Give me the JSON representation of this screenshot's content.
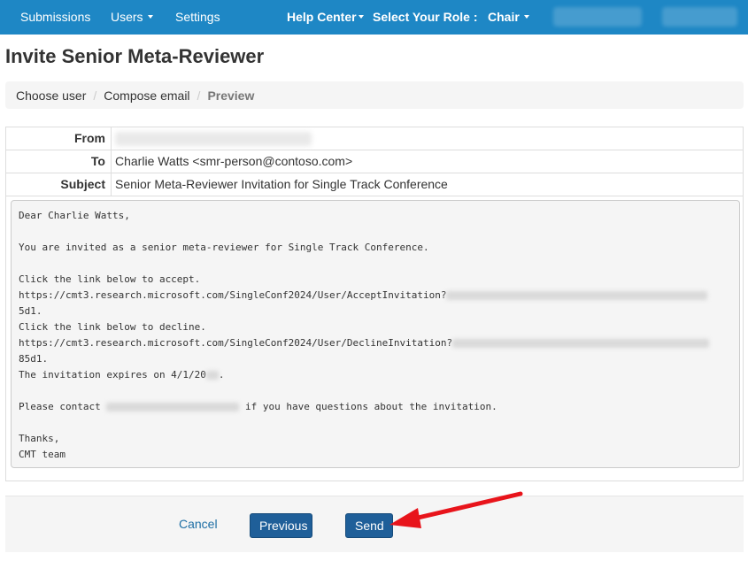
{
  "nav": {
    "submissions": "Submissions",
    "users": "Users",
    "settings": "Settings",
    "help_center": "Help Center",
    "select_role": "Select Your Role :",
    "role": "Chair"
  },
  "page": {
    "title": "Invite Senior Meta-Reviewer"
  },
  "breadcrumb": {
    "items": [
      {
        "label": "Choose user"
      },
      {
        "label": "Compose email"
      },
      {
        "label": "Preview"
      }
    ],
    "separator": "/"
  },
  "email": {
    "from_label": "From",
    "to_label": "To",
    "to_value": "Charlie Watts <smr-person@contoso.com>",
    "subject_label": "Subject",
    "subject_value": "Senior Meta-Reviewer Invitation for Single Track Conference",
    "body": {
      "greeting": "Dear Charlie Watts,",
      "intro": "You are invited as a senior meta-reviewer for Single Track Conference.",
      "accept_line": "Click the link below to accept.",
      "accept_url": "https://cmt3.research.microsoft.com/SingleConf2024/User/AcceptInvitation?",
      "accept_tail": "5d1.",
      "decline_line": "Click the link below to decline.",
      "decline_url": "https://cmt3.research.microsoft.com/SingleConf2024/User/DeclineInvitation?",
      "decline_tail": "85d1.",
      "expires": "The invitation expires on 4/1/20",
      "expires_end": ".",
      "contact_start": "Please contact ",
      "contact_end": " if you have questions about the invitation.",
      "thanks": "Thanks,",
      "signature": "CMT team"
    }
  },
  "actions": {
    "cancel": "Cancel",
    "previous": "Previous",
    "send": "Send"
  },
  "colors": {
    "navbar": "#1e87c5",
    "button": "#1f5f99",
    "arrow": "#e8141b"
  }
}
